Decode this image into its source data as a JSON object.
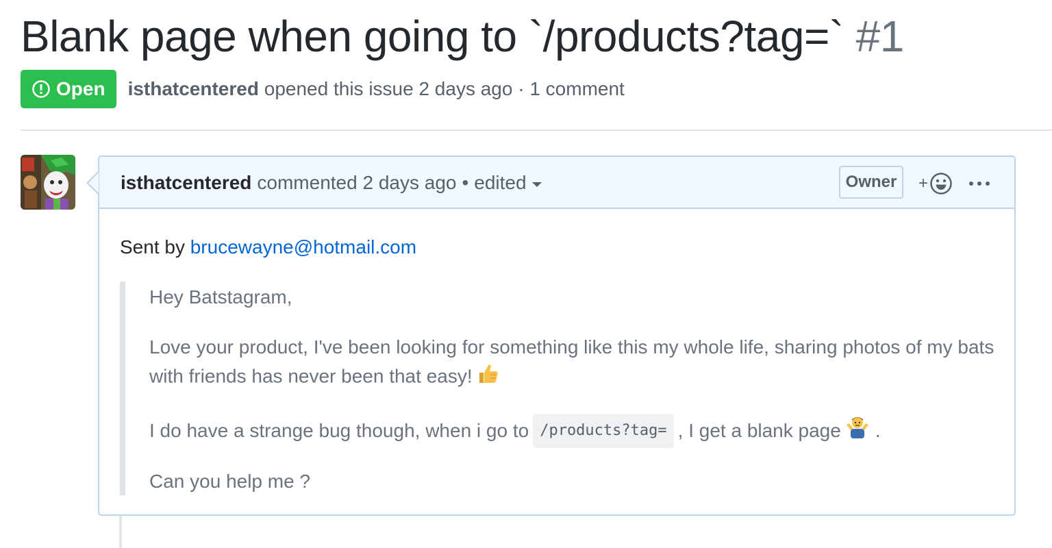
{
  "issue": {
    "title": "Blank page when going to `/products?tag=`",
    "number": "#1",
    "state": "Open",
    "author": "isthatcentered",
    "meta_text": "opened this issue 2 days ago · 1 comment"
  },
  "comment": {
    "author": "isthatcentered",
    "action": "commented 2 days ago",
    "separator": "•",
    "edited_label": "edited",
    "owner_badge": "Owner",
    "reaction_plus": "+",
    "sent_by_label": "Sent by",
    "sender_email": "brucewayne@hotmail.com",
    "quote": {
      "greeting": "Hey Batstagram,",
      "paragraph1": "Love your product, I've been looking for something like this my whole life, sharing photos of my bats with friends has never been that easy!",
      "paragraph2_before": "I do have a strange bug though, when i go to",
      "paragraph2_code": "/products?tag=",
      "paragraph2_after": ", I get a blank page",
      "paragraph2_end": ".",
      "closing": "Can you help me ?"
    }
  },
  "icons": {
    "state": "issue-opened-icon",
    "reaction": "smiley-icon",
    "more": "kebab-horizontal-icon",
    "emoji1": "thumbs-up-emoji",
    "emoji2": "person-shrugging-emoji"
  },
  "colors": {
    "open_green": "#2cbe4e",
    "link_blue": "#0366d6",
    "header_bg": "#f1f8ff",
    "border_blue": "#c0d3eb"
  }
}
